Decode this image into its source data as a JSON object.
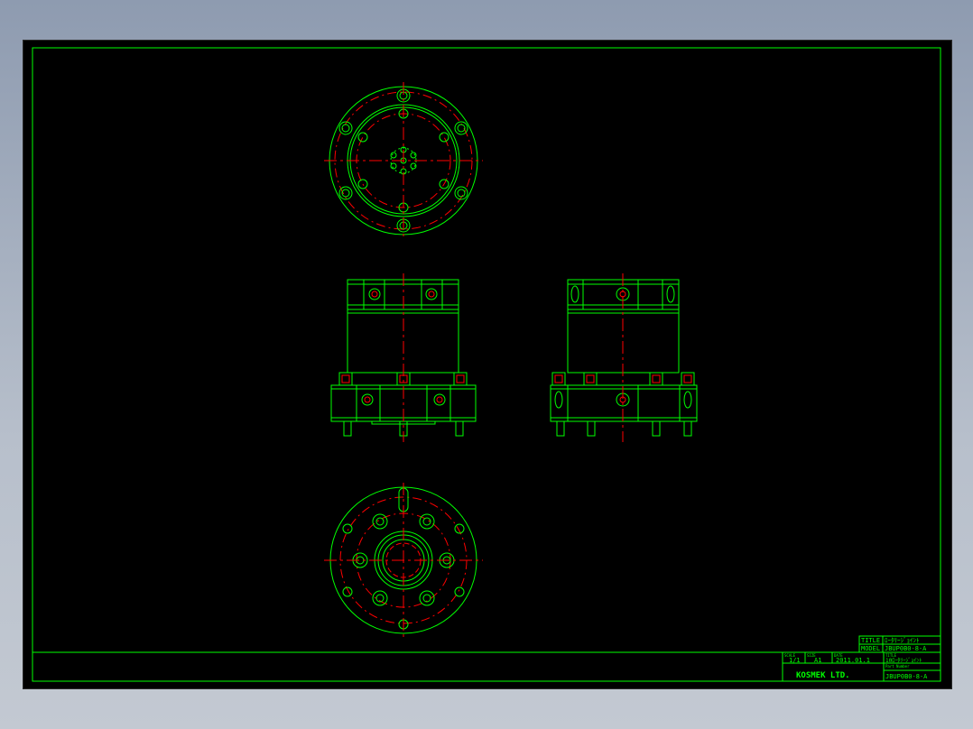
{
  "colors": {
    "sheet_background": "#000000",
    "outline": "#00ff00",
    "center_lines": "#ff0000",
    "frame": "#00ff00"
  },
  "title_block": {
    "title_label": "TITLE",
    "title_value": "ﾛｰﾀﾘｰｼﾞｮｲﾝﾄ",
    "model_label": "MODEL",
    "model_value": "JBUP0B0-8-A",
    "scale_label": "SCALE",
    "scale_value": "1/1",
    "size_label": "SIZE",
    "size_value": "A1",
    "date_label": "DATE",
    "date_value": "2011.01.1",
    "name_label": "TITLE",
    "name_value": "10ﾛｰﾀﾘｰｼﾞｮｲﾝﾄ",
    "part_label": "Part Number",
    "part_value": "JBUP0B0-8-A",
    "company": "KOSMEK LTD."
  }
}
